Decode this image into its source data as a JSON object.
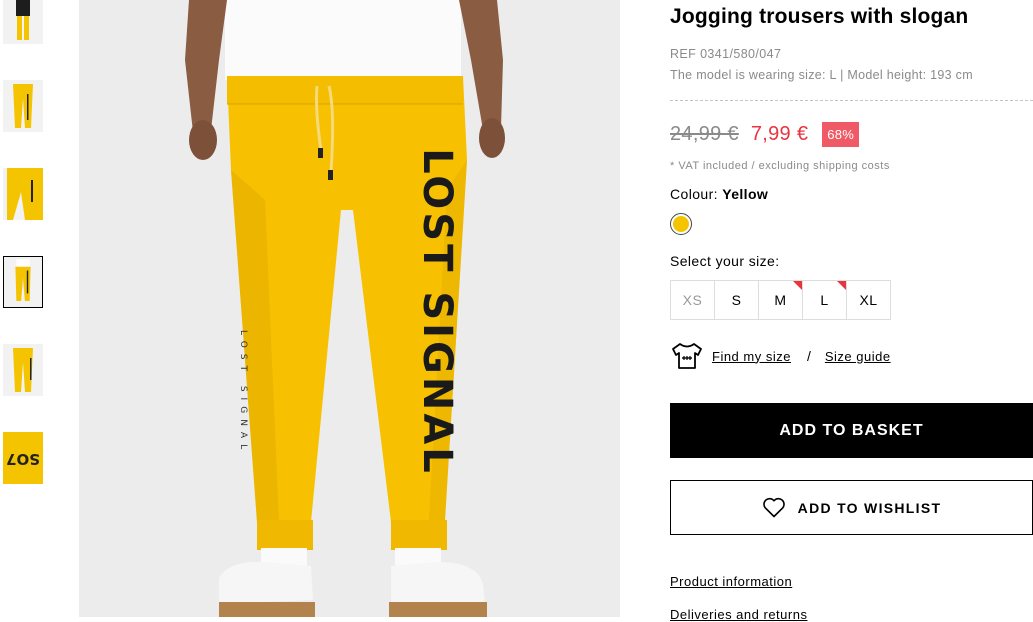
{
  "product": {
    "title": "Jogging trousers with slogan",
    "ref": "REF 0341/580/047",
    "model_info": "The model is wearing size: L | Model height: 193 cm",
    "old_price": "24,99 €",
    "new_price": "7,99 €",
    "discount": "68%",
    "vat_note": "* VAT included / excluding shipping costs",
    "colour_label": "Colour:",
    "colour_name": "Yellow",
    "colour_hex": "#f5c400",
    "select_size_label": "Select your size:",
    "sizes": [
      {
        "label": "XS",
        "available": false,
        "low_stock": false
      },
      {
        "label": "S",
        "available": true,
        "low_stock": false
      },
      {
        "label": "M",
        "available": true,
        "low_stock": true
      },
      {
        "label": "L",
        "available": true,
        "low_stock": true
      },
      {
        "label": "XL",
        "available": true,
        "low_stock": false
      }
    ],
    "slogan": "LOST SIGNAL"
  },
  "actions": {
    "find_my_size": "Find my size",
    "separator": "/",
    "size_guide": "Size guide",
    "add_to_basket": "ADD TO BASKET",
    "add_to_wishlist": "ADD TO WISHLIST"
  },
  "info_links": {
    "product_information": "Product information",
    "deliveries_returns": "Deliveries and returns"
  },
  "colors": {
    "accent_red": "#e8343f",
    "discount_bg": "#ef5a66",
    "primary_button": "#000000",
    "yellow": "#f5c400"
  }
}
